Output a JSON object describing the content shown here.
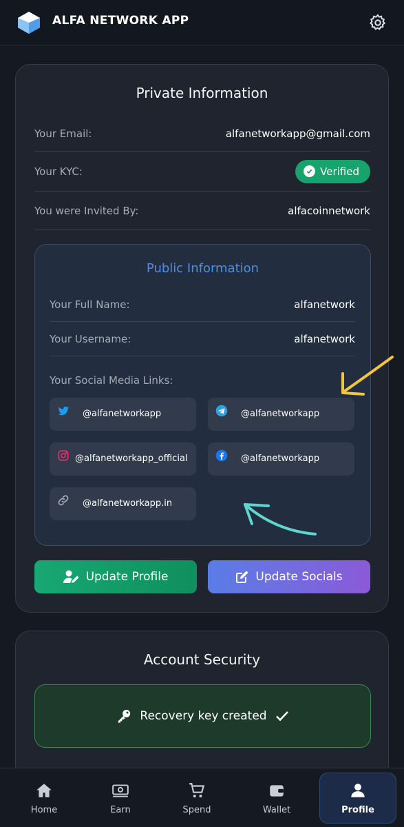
{
  "header": {
    "title": "ALFA NETWORK APP",
    "logo_icon": "alfa-logo-icon",
    "settings_icon": "gear-icon"
  },
  "private_info": {
    "title": "Private Information",
    "email_label": "Your Email:",
    "email_value": "alfanetworkapp@gmail.com",
    "kyc_label": "Your KYC:",
    "kyc_status": "Verified",
    "invited_label": "You were Invited By:",
    "invited_value": "alfacoinnetwork"
  },
  "public_info": {
    "title": "Public Information",
    "full_name_label": "Your Full Name:",
    "full_name_value": "alfanetwork",
    "username_label": "Your Username:",
    "username_value": "alfanetwork",
    "social_label": "Your Social Media Links:",
    "socials": [
      {
        "icon": "twitter-icon",
        "handle": "@alfanetworkapp"
      },
      {
        "icon": "telegram-icon",
        "handle": "@alfanetworkapp"
      },
      {
        "icon": "instagram-icon",
        "handle": "@alfanetworkapp_official"
      },
      {
        "icon": "facebook-icon",
        "handle": "@alfanetworkapp"
      },
      {
        "icon": "link-icon",
        "handle": "@alfanetworkapp.in"
      }
    ]
  },
  "actions": {
    "update_profile": "Update Profile",
    "update_socials": "Update Socials"
  },
  "security": {
    "title": "Account Security",
    "recovery_text": "Recovery key created"
  },
  "nav": {
    "items": [
      {
        "label": "Home",
        "icon": "home-icon"
      },
      {
        "label": "Earn",
        "icon": "earn-icon"
      },
      {
        "label": "Spend",
        "icon": "cart-icon"
      },
      {
        "label": "Wallet",
        "icon": "wallet-icon"
      },
      {
        "label": "Profile",
        "icon": "user-icon",
        "active": true
      }
    ]
  },
  "colors": {
    "background": "#151a22",
    "card": "#1f242e",
    "public_card": "#222d3f",
    "accent_blue": "#4f8fe0",
    "verified_green": "#18a36c",
    "arrow_yellow": "#f2c63a",
    "arrow_cyan": "#5fd6d0"
  }
}
